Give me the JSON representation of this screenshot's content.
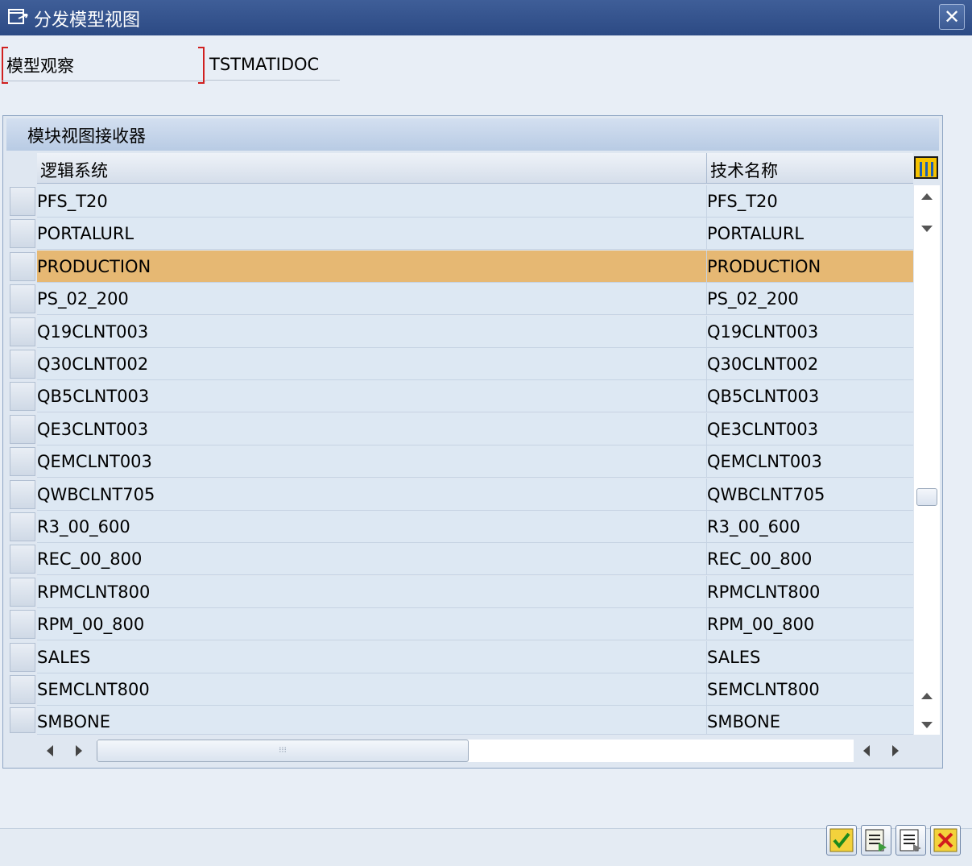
{
  "window": {
    "title": "分发模型视图",
    "close_label": "✕"
  },
  "field": {
    "label": "模型观察",
    "value": "TSTMATIDOC"
  },
  "table": {
    "title": "模块视图接收器",
    "columns": [
      "逻辑系统",
      "技术名称"
    ],
    "rows": [
      {
        "logical_system": "PFS_T20",
        "technical_name": "PFS_T20",
        "selected": false
      },
      {
        "logical_system": "PORTALURL",
        "technical_name": "PORTALURL",
        "selected": false
      },
      {
        "logical_system": "PRODUCTION",
        "technical_name": "PRODUCTION",
        "selected": true
      },
      {
        "logical_system": "PS_02_200",
        "technical_name": "PS_02_200",
        "selected": false
      },
      {
        "logical_system": "Q19CLNT003",
        "technical_name": "Q19CLNT003",
        "selected": false
      },
      {
        "logical_system": "Q30CLNT002",
        "technical_name": "Q30CLNT002",
        "selected": false
      },
      {
        "logical_system": "QB5CLNT003",
        "technical_name": "QB5CLNT003",
        "selected": false
      },
      {
        "logical_system": "QE3CLNT003",
        "technical_name": "QE3CLNT003",
        "selected": false
      },
      {
        "logical_system": "QEMCLNT003",
        "technical_name": "QEMCLNT003",
        "selected": false
      },
      {
        "logical_system": "QWBCLNT705",
        "technical_name": "QWBCLNT705",
        "selected": false
      },
      {
        "logical_system": "R3_00_600",
        "technical_name": "R3_00_600",
        "selected": false
      },
      {
        "logical_system": "REC_00_800",
        "technical_name": "REC_00_800",
        "selected": false
      },
      {
        "logical_system": "RPMCLNT800",
        "technical_name": "RPMCLNT800",
        "selected": false
      },
      {
        "logical_system": "RPM_00_800",
        "technical_name": "RPM_00_800",
        "selected": false
      },
      {
        "logical_system": "SALES",
        "technical_name": "SALES",
        "selected": false
      },
      {
        "logical_system": "SEMCLNT800",
        "technical_name": "SEMCLNT800",
        "selected": false
      },
      {
        "logical_system": "SMBONE",
        "technical_name": "SMBONE",
        "selected": false
      }
    ]
  },
  "toolbar": {
    "buttons": [
      "checkmark-icon",
      "detail-icon",
      "detail-alt-icon",
      "cancel-x-icon"
    ]
  },
  "colors": {
    "titlebar": "#2c4a84",
    "row": "#dde8f3",
    "selected_row": "#e6b873",
    "required_marker": "#d02020"
  }
}
